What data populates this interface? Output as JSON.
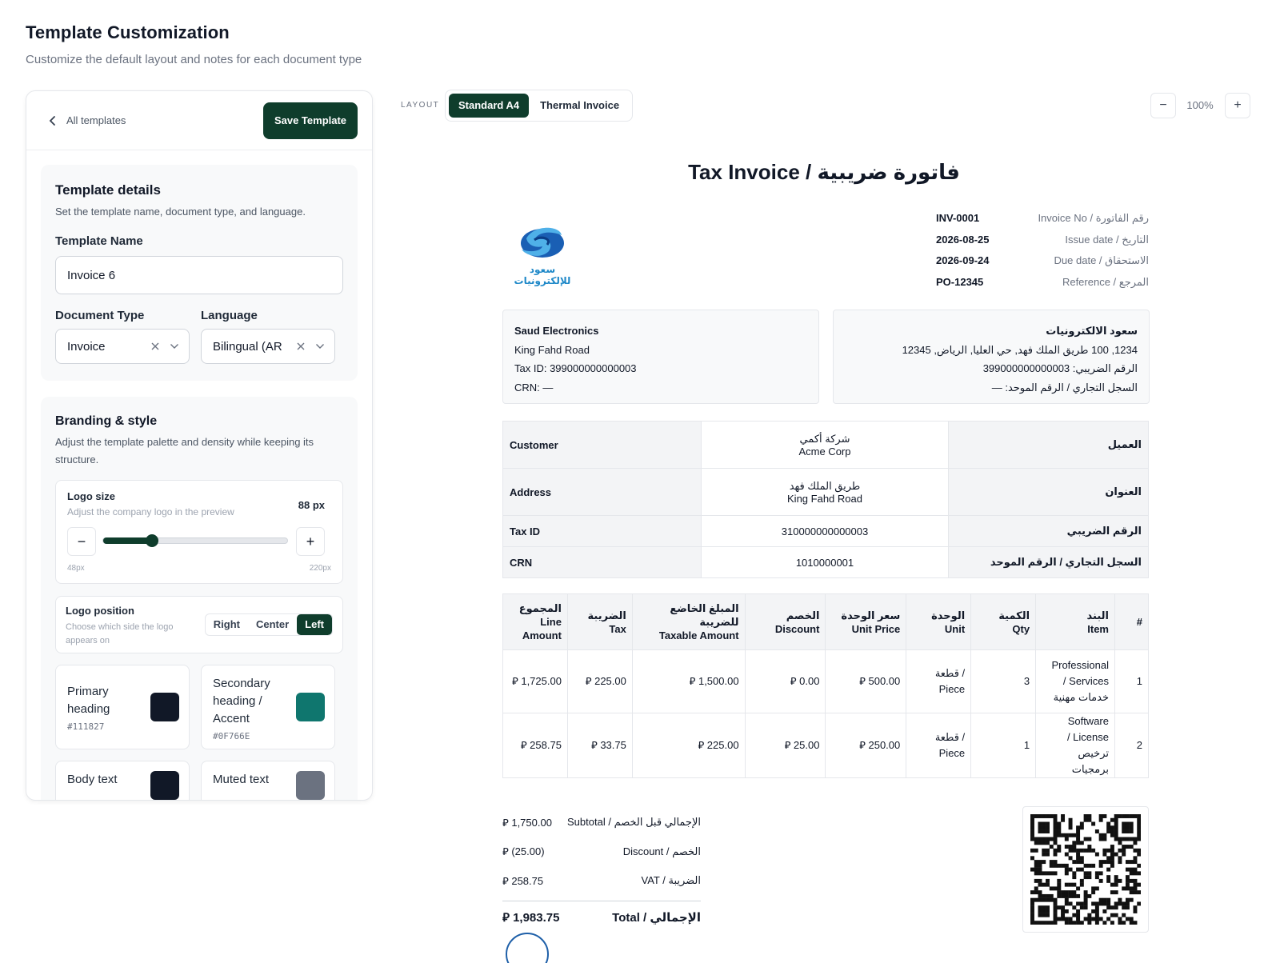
{
  "page": {
    "title": "Template Customization",
    "subtitle": "Customize the default layout and notes for each document type"
  },
  "panel": {
    "back_label": "All templates",
    "save_label": "Save Template"
  },
  "details": {
    "title": "Template details",
    "desc": "Set the template name, document type, and language.",
    "name_label": "Template Name",
    "name_value": "Invoice 6",
    "doctype_label": "Document Type",
    "doctype_value": "Invoice",
    "language_label": "Language",
    "language_value": "Bilingual (AR"
  },
  "branding": {
    "title": "Branding & style",
    "desc": "Adjust the template palette and density while keeping its structure.",
    "logo_size": {
      "title": "Logo size",
      "desc": "Adjust the company logo in the preview",
      "value_label": "88 px",
      "min_label": "48px",
      "max_label": "220px",
      "fraction": 0.23
    },
    "logo_position": {
      "title": "Logo position",
      "desc": "Choose which side the logo appears on",
      "options": [
        "Right",
        "Center",
        "Left"
      ],
      "selected": "Left"
    },
    "colors": [
      {
        "name": "Primary heading",
        "hex": "#111827",
        "color": "#111827"
      },
      {
        "name": "Secondary heading / Accent",
        "hex": "#0F766E",
        "color": "#0f766e"
      },
      {
        "name": "Body text",
        "color": "#111827"
      },
      {
        "name": "Muted text",
        "color": "#6b7280"
      }
    ]
  },
  "toolbar": {
    "layout_label": "LAYOUT",
    "layout_options": [
      "Standard A4",
      "Thermal Invoice"
    ],
    "zoom_out": "−",
    "zoom_value": "100%",
    "zoom_in": "+"
  },
  "invoice": {
    "title": "Tax Invoice / فاتورة ضريبية",
    "logo_text": "سعود للإلكترونيات",
    "meta": [
      {
        "value": "INV-0001",
        "label": "Invoice No / رقم الفاتورة"
      },
      {
        "value": "2026-08-25",
        "label": "Issue date / التاريخ"
      },
      {
        "value": "2026-09-24",
        "label": "Due date / الاستحقاق"
      },
      {
        "value": "PO-12345",
        "label": "Reference / المرجع"
      }
    ],
    "seller_en": [
      "Saud Electronics",
      "King Fahd Road",
      "Tax ID: 399000000000003",
      "CRN: —"
    ],
    "seller_ar": [
      "سعود الالكترونيات",
      "1234, 100 طريق الملك فهد, حي العليا, الرياض, 12345",
      "الرقم الضريبي: 399000000000003",
      "السجل التجاري / الرقم الموحد: —"
    ],
    "customer": {
      "rows": [
        {
          "label": "Customer",
          "value_ar": "شركة أكمي",
          "value": "Acme Corp",
          "label_ar": "العميل"
        },
        {
          "label": "Address",
          "value_ar": "طريق الملك فهد",
          "value": "King Fahd Road",
          "label_ar": "العنوان"
        },
        {
          "label": "Tax ID",
          "value_ar": "",
          "value": "310000000000003",
          "label_ar": "الرقم الضريبي"
        },
        {
          "label": "CRN",
          "value_ar": "",
          "value": "1010000001",
          "label_ar": "السجل التجاري / الرقم الموحد"
        }
      ]
    },
    "items": {
      "headers": [
        {
          "ar": "المجموع",
          "en": "Line Amount"
        },
        {
          "ar": "الضريبة",
          "en": "Tax"
        },
        {
          "ar": "المبلغ الخاضع للضريبة",
          "en": "Taxable Amount"
        },
        {
          "ar": "الخصم",
          "en": "Discount"
        },
        {
          "ar": "سعر الوحدة",
          "en": "Unit Price"
        },
        {
          "ar": "الوحدة",
          "en": "Unit"
        },
        {
          "ar": "الكمية",
          "en": "Qty"
        },
        {
          "ar": "البند",
          "en": "Item"
        },
        {
          "ar": "#",
          "en": ""
        }
      ],
      "rows": [
        {
          "line": "⃁ 1,725.00",
          "tax": "⃁ 225.00",
          "taxable": "⃁ 1,500.00",
          "discount": "⃁ 0.00",
          "unit_price": "⃁ 500.00",
          "unit_1": "قطعة /",
          "unit_2": "Piece",
          "qty": "3",
          "item_1": "Professional",
          "item_2": "/ Services",
          "item_3": "خدمات مهنية",
          "num": "1"
        },
        {
          "line": "⃁ 258.75",
          "tax": "⃁ 33.75",
          "taxable": "⃁ 225.00",
          "discount": "⃁ 25.00",
          "unit_price": "⃁ 250.00",
          "unit_1": "قطعة /",
          "unit_2": "Piece",
          "qty": "1",
          "item_1": "Software",
          "item_2": "/ License",
          "item_3": "ترخيص برمجيات",
          "num": "2"
        }
      ]
    },
    "totals": [
      {
        "value": "⃁ 1,750.00",
        "label": "Subtotal / الإجمالي قبل الخصم"
      },
      {
        "value": "⃁ (25.00)",
        "label": "Discount / الخصم"
      },
      {
        "value": "⃁ 258.75",
        "label": "VAT / الضريبة"
      }
    ],
    "total": {
      "value": "⃁ 1,983.75",
      "label": "Total / الإجمالي"
    }
  }
}
